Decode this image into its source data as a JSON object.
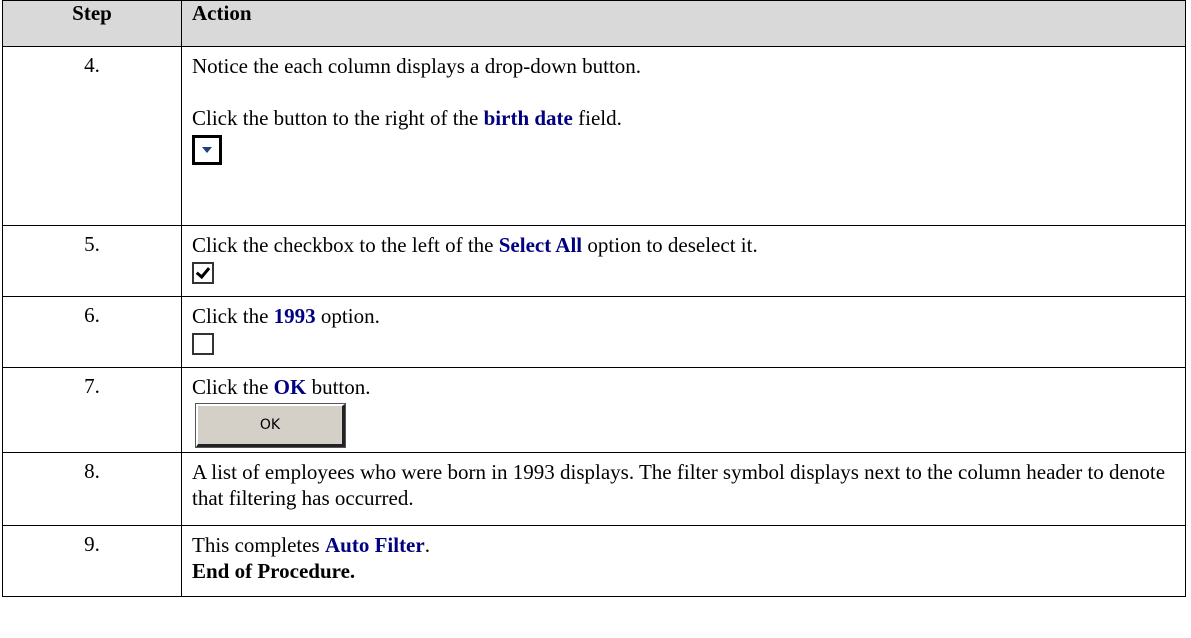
{
  "header": {
    "step": "Step",
    "action": "Action"
  },
  "rows": [
    {
      "num": "4.",
      "line1": "Notice the each column displays a drop-down button.",
      "pre": "Click the button to the right of the ",
      "kw": "birth date",
      "post": " field."
    },
    {
      "num": "5.",
      "pre": "Click the checkbox to the left of the ",
      "kw": "Select All",
      "post": " option to deselect it."
    },
    {
      "num": "6.",
      "pre": "Click the ",
      "kw": "1993",
      "post": " option."
    },
    {
      "num": "7.",
      "pre": "Click the ",
      "kw": "OK",
      "post": " button.",
      "button_label": "OK"
    },
    {
      "num": "8.",
      "text": "A list of employees who were born in 1993 displays. The filter symbol displays next to the column header to denote that filtering has occurred."
    },
    {
      "num": "9.",
      "pre": "This completes ",
      "kw": "Auto Filter",
      "post": ".",
      "end": "End of Procedure."
    }
  ]
}
